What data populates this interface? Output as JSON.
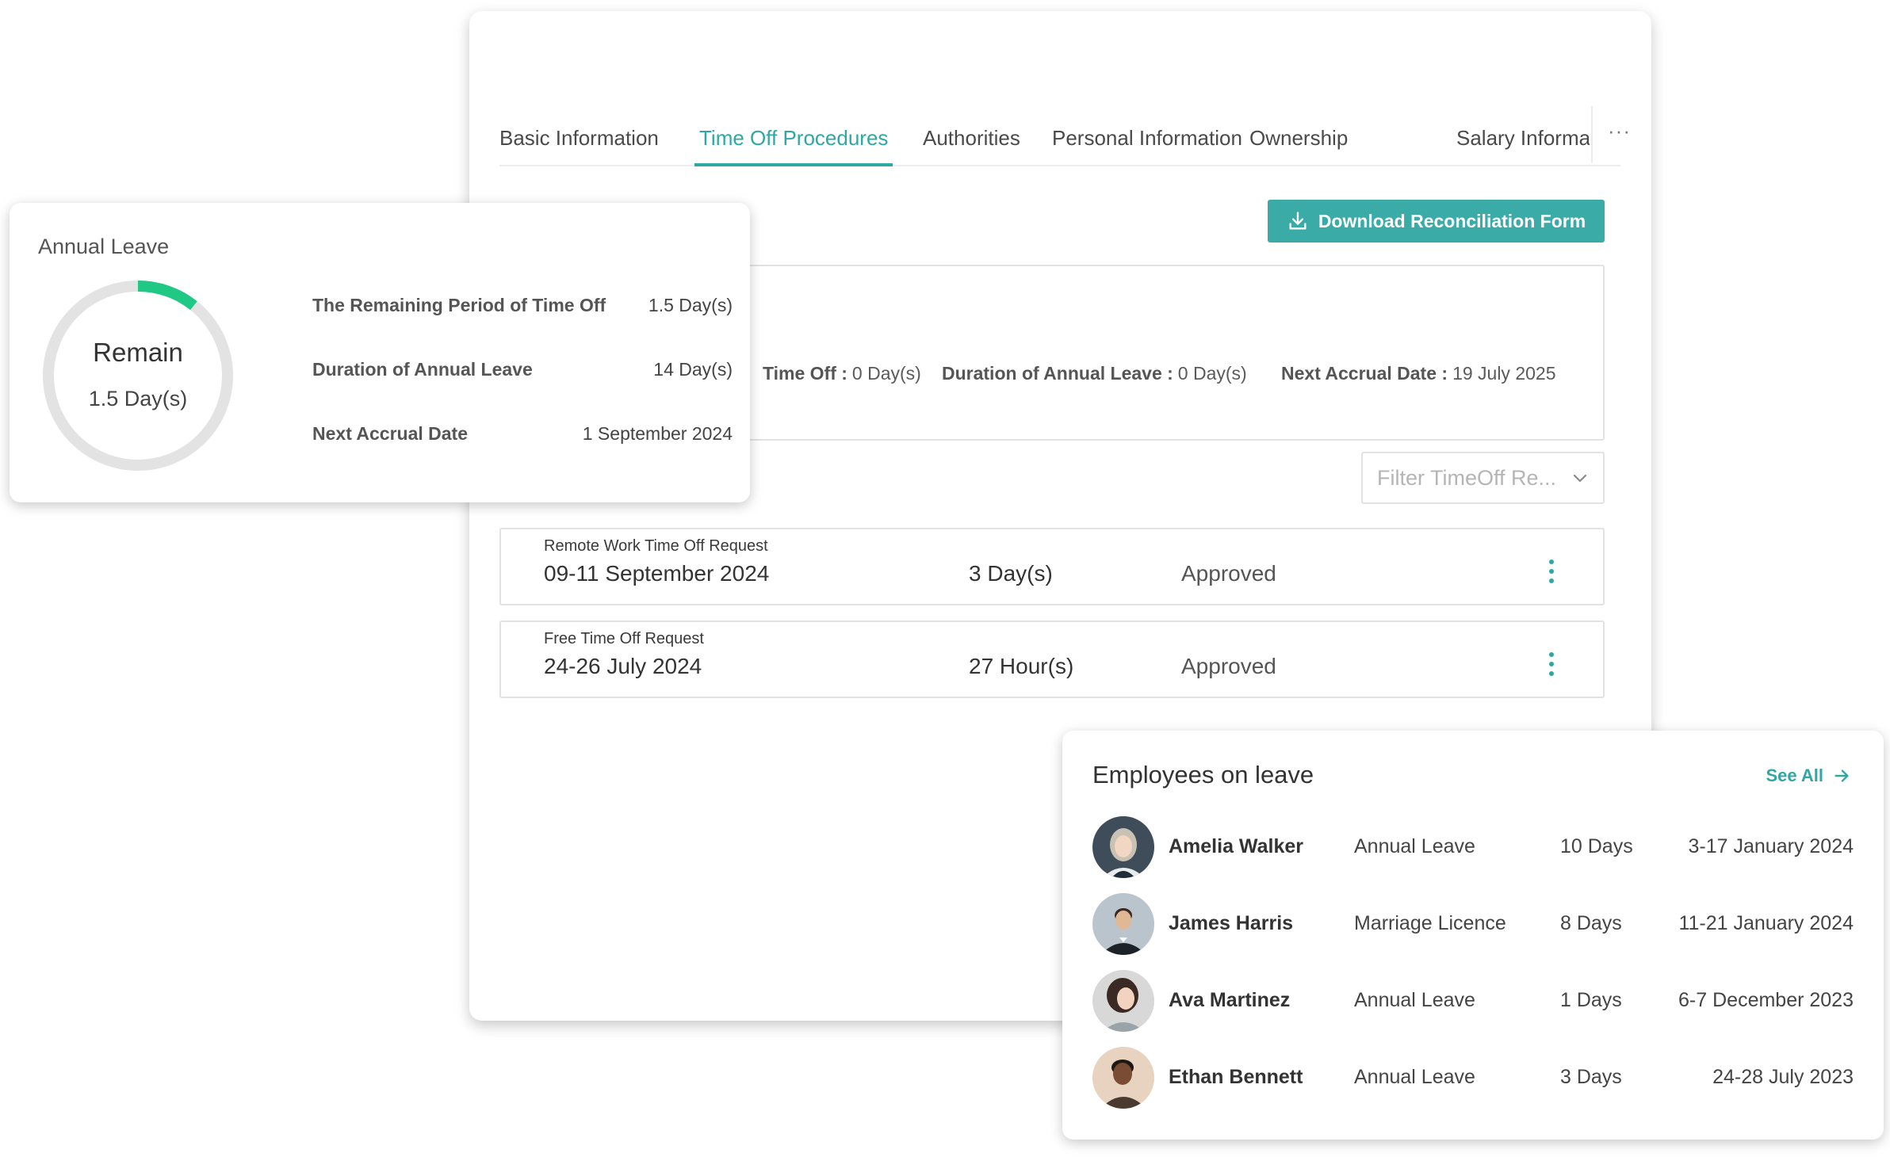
{
  "tabs": [
    {
      "label": "Basic Information"
    },
    {
      "label": "Time Off Procedures"
    },
    {
      "label": "Authorities"
    },
    {
      "label": "Personal Information"
    },
    {
      "label": "Ownership"
    },
    {
      "label": "Salary Information"
    }
  ],
  "more_label": "···",
  "download_label": "Download Reconciliation Form",
  "summary": {
    "items": [
      {
        "label": "Time Off :",
        "value": "0 Day(s)"
      },
      {
        "label": "Duration of Annual Leave :",
        "value": "0 Day(s)"
      },
      {
        "label": "Next Accrual Date :",
        "value": "19 July 2025"
      }
    ]
  },
  "filter": {
    "placeholder": "Filter TimeOff Re..."
  },
  "requests": [
    {
      "type": "Remote Work Time Off Request",
      "date": "09-11 September 2024",
      "duration": "3 Day(s)",
      "status": "Approved"
    },
    {
      "type": "Free Time Off Request",
      "date": "24-26 July 2024",
      "duration": "27 Hour(s)",
      "status": "Approved"
    }
  ],
  "annual_leave": {
    "title": "Annual Leave",
    "ring_label": "Remain",
    "ring_value": "1.5 Day(s)",
    "remaining_fraction": 0.107,
    "stats": [
      {
        "label": "The Remaining Period of Time Off",
        "value": "1.5 Day(s)"
      },
      {
        "label": "Duration of Annual Leave",
        "value": "14 Day(s)"
      },
      {
        "label": "Next Accrual Date",
        "value": "1 September 2024"
      }
    ]
  },
  "employees_on_leave": {
    "title": "Employees on leave",
    "see_all": "See All",
    "rows": [
      {
        "name": "Amelia Walker",
        "type": "Annual Leave",
        "days": "10 Days",
        "range": "3-17 January 2024"
      },
      {
        "name": "James Harris",
        "type": "Marriage Licence",
        "days": "8 Days",
        "range": "11-21 January 2024"
      },
      {
        "name": "Ava Martinez",
        "type": "Annual Leave",
        "days": "1 Days",
        "range": "6-7 December 2023"
      },
      {
        "name": "Ethan Bennett",
        "type": "Annual Leave",
        "days": "3 Days",
        "range": "24-28 July 2023"
      }
    ]
  },
  "colors": {
    "accent": "#2ea8a5",
    "ring_progress": "#1fc985",
    "ring_track": "#e3e3e3"
  }
}
